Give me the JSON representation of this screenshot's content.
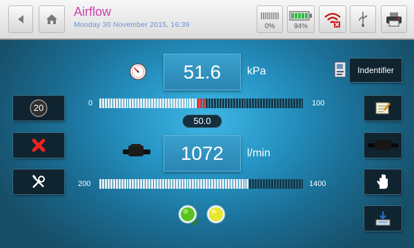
{
  "header": {
    "title": "Airflow",
    "datetime": "Monday 30 November 2015, 16:39",
    "status": {
      "storage_label": "0%",
      "battery_label": "94%"
    },
    "icons": [
      "back-arrow-icon",
      "home-icon",
      "storage-icon",
      "battery-icon",
      "wifi-disconnected-icon",
      "usb-icon",
      "printer-icon"
    ]
  },
  "pressure": {
    "value": "51.6",
    "unit": "kPa",
    "scale_min": "0",
    "scale_max": "100",
    "setpoint": "50.0",
    "level_fraction": 0.516,
    "setpoint_fraction": 0.5
  },
  "flow": {
    "value": "1072",
    "unit": "l/min",
    "scale_min": "200",
    "scale_max": "1400",
    "level_fraction": 0.727
  },
  "left_buttons": {
    "timer_label": "20",
    "icons": [
      "timer-icon",
      "cancel-icon",
      "tools-icon"
    ]
  },
  "right_buttons": {
    "identifier_label": "Indentifier",
    "icons": [
      "identifier-icon",
      "notes-icon",
      "nozzle-icon",
      "manual-hand-icon",
      "save-to-drive-icon"
    ]
  },
  "indicators": {
    "colors": {
      "green": "#59c21f",
      "yellow": "#e8e62a"
    }
  },
  "colors": {
    "accent_title": "#cc3fae",
    "date_text": "#6a8fd6",
    "bar_filled": "#e6eef2",
    "bar_empty": "#173848",
    "marker": "#d8322f"
  }
}
